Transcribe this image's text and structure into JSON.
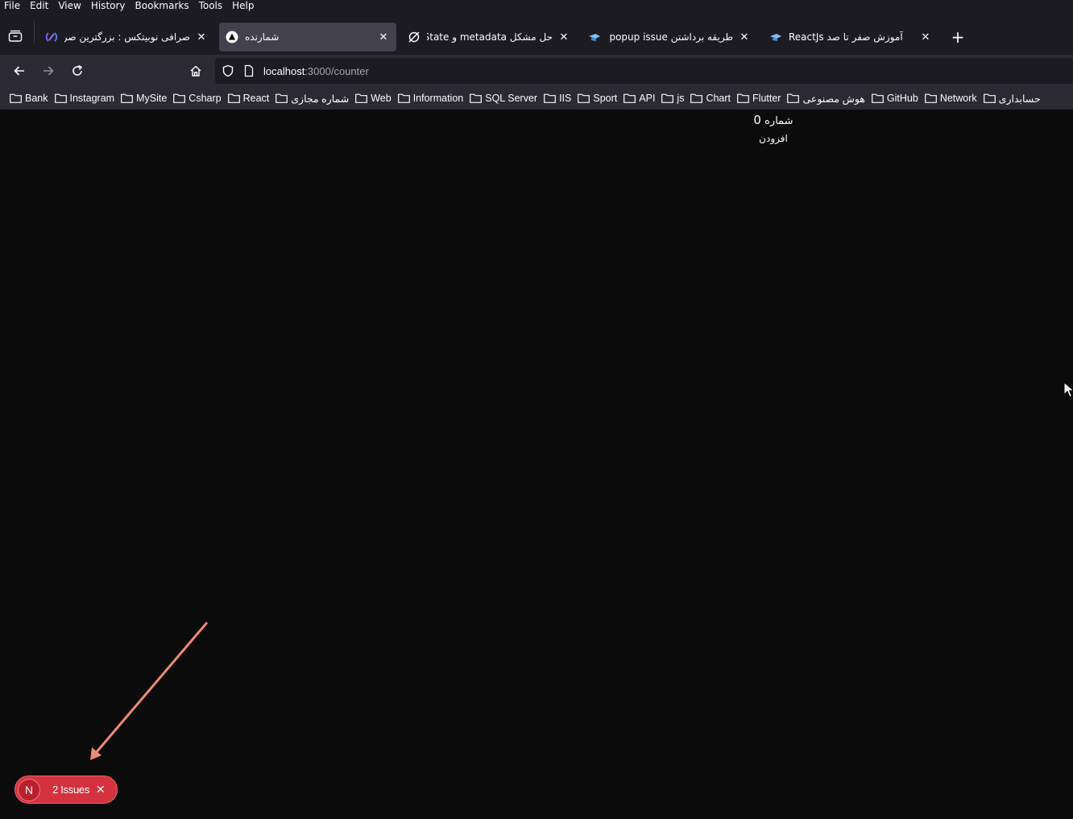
{
  "menu": [
    "File",
    "Edit",
    "View",
    "History",
    "Bookmarks",
    "Tools",
    "Help"
  ],
  "tabs": [
    {
      "title": "صرافی نوبیتکس : بزرگترین صرافی",
      "favicon": "nobitex-icon",
      "active": false
    },
    {
      "title": "شمارنده",
      "favicon": "nextjs-icon",
      "active": true
    },
    {
      "title": "حل مشکل metadata و useState",
      "favicon": "nosync-icon",
      "active": false
    },
    {
      "title": "طریقه برداشتن popup issue در",
      "favicon": "graduation-cap-icon",
      "active": false
    },
    {
      "title": "آموزش صفر تا صد ReactJs",
      "favicon": "graduation-cap-icon",
      "active": false
    }
  ],
  "url": {
    "host": "localhost",
    "path": ":3000/counter"
  },
  "bookmarks": [
    "Bank",
    "Instagram",
    "MySite",
    "Csharp",
    "React",
    "شماره مجازی",
    "Web",
    "Information",
    "SQL Server",
    "IIS",
    "Sport",
    "API",
    "js",
    "Chart",
    "Flutter",
    "هوش مصنوعی",
    "GitHub",
    "Network",
    "حسابداری"
  ],
  "page": {
    "counter_label": "شماره",
    "counter_value": "0",
    "add_button": "افزودن"
  },
  "issues_badge": {
    "initial": "N",
    "label": "2 Issues"
  },
  "colors": {
    "badge": "#d5323f",
    "arrow": "#f08a73",
    "content_bg": "#0b0b0b"
  }
}
